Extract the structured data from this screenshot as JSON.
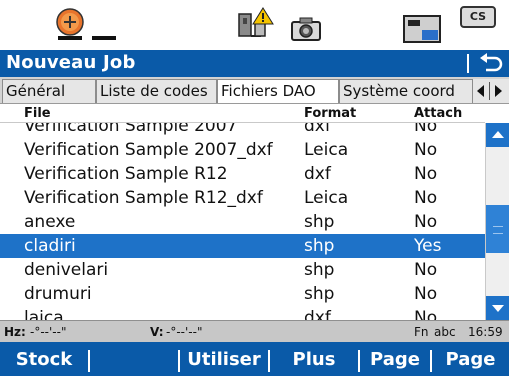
{
  "status_icons": [
    "satellite-icon",
    "instrument-warning-icon",
    "camera-icon",
    "memory-card-icon",
    "cs-icon"
  ],
  "status_cs_label": "CS",
  "header": {
    "title": "Nouveau Job"
  },
  "tabs": [
    {
      "label": "Général"
    },
    {
      "label": "Liste de codes"
    },
    {
      "label": "Fichiers DAO",
      "active": true
    },
    {
      "label": "Système coord"
    }
  ],
  "table": {
    "columns": {
      "file": "File",
      "format": "Format",
      "attach": "Attach"
    },
    "rows": [
      {
        "file": "Verification Sample 2007",
        "format": "dxf",
        "attach": "No"
      },
      {
        "file": "Verification Sample 2007_dxf",
        "format": "Leica",
        "attach": "No"
      },
      {
        "file": "Verification Sample R12",
        "format": "dxf",
        "attach": "No"
      },
      {
        "file": "Verification Sample R12_dxf",
        "format": "Leica",
        "attach": "No"
      },
      {
        "file": "anexe",
        "format": "shp",
        "attach": "No"
      },
      {
        "file": "cladiri",
        "format": "shp",
        "attach": "Yes",
        "selected": true
      },
      {
        "file": "denivelari",
        "format": "shp",
        "attach": "No"
      },
      {
        "file": "drumuri",
        "format": "shp",
        "attach": "No"
      },
      {
        "file": "laica",
        "format": "dxf",
        "attach": "No"
      }
    ]
  },
  "infobar": {
    "hz_label": "Hz:",
    "hz_value": "-°--'--\"",
    "v_label": "V:",
    "v_value": "-°--'--\"",
    "fn": "Fn",
    "input_mode": "abc",
    "time": "16:59"
  },
  "softkeys": [
    "Stock",
    "",
    "Utiliser",
    "Plus",
    "Page"
  ],
  "colors": {
    "brand_blue": "#0a5aa8",
    "selection_blue": "#1e72c8",
    "bar_gray": "#c7c7c7"
  }
}
